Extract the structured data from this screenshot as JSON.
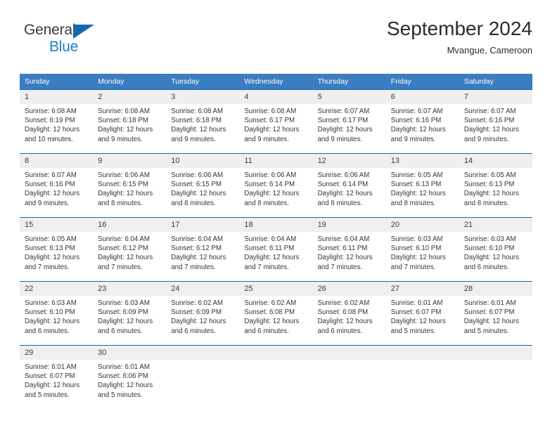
{
  "brand": {
    "name_part1": "General",
    "name_part2": "Blue",
    "accent_color": "#1a7cc4",
    "triangle_color": "#1268b3"
  },
  "header": {
    "month_title": "September 2024",
    "location": "Mvangue, Cameroon"
  },
  "calendar": {
    "header_bg": "#3a7dc0",
    "week_rule_color": "#1668b0",
    "date_band_bg": "#efefef",
    "day_names": [
      "Sunday",
      "Monday",
      "Tuesday",
      "Wednesday",
      "Thursday",
      "Friday",
      "Saturday"
    ],
    "weeks": [
      {
        "days": [
          {
            "date": "1",
            "sunrise": "Sunrise: 6:08 AM",
            "sunset": "Sunset: 6:19 PM",
            "daylight1": "Daylight: 12 hours",
            "daylight2": "and 10 minutes."
          },
          {
            "date": "2",
            "sunrise": "Sunrise: 6:08 AM",
            "sunset": "Sunset: 6:18 PM",
            "daylight1": "Daylight: 12 hours",
            "daylight2": "and 9 minutes."
          },
          {
            "date": "3",
            "sunrise": "Sunrise: 6:08 AM",
            "sunset": "Sunset: 6:18 PM",
            "daylight1": "Daylight: 12 hours",
            "daylight2": "and 9 minutes."
          },
          {
            "date": "4",
            "sunrise": "Sunrise: 6:08 AM",
            "sunset": "Sunset: 6:17 PM",
            "daylight1": "Daylight: 12 hours",
            "daylight2": "and 9 minutes."
          },
          {
            "date": "5",
            "sunrise": "Sunrise: 6:07 AM",
            "sunset": "Sunset: 6:17 PM",
            "daylight1": "Daylight: 12 hours",
            "daylight2": "and 9 minutes."
          },
          {
            "date": "6",
            "sunrise": "Sunrise: 6:07 AM",
            "sunset": "Sunset: 6:16 PM",
            "daylight1": "Daylight: 12 hours",
            "daylight2": "and 9 minutes."
          },
          {
            "date": "7",
            "sunrise": "Sunrise: 6:07 AM",
            "sunset": "Sunset: 6:16 PM",
            "daylight1": "Daylight: 12 hours",
            "daylight2": "and 9 minutes."
          }
        ]
      },
      {
        "days": [
          {
            "date": "8",
            "sunrise": "Sunrise: 6:07 AM",
            "sunset": "Sunset: 6:16 PM",
            "daylight1": "Daylight: 12 hours",
            "daylight2": "and 9 minutes."
          },
          {
            "date": "9",
            "sunrise": "Sunrise: 6:06 AM",
            "sunset": "Sunset: 6:15 PM",
            "daylight1": "Daylight: 12 hours",
            "daylight2": "and 8 minutes."
          },
          {
            "date": "10",
            "sunrise": "Sunrise: 6:06 AM",
            "sunset": "Sunset: 6:15 PM",
            "daylight1": "Daylight: 12 hours",
            "daylight2": "and 8 minutes."
          },
          {
            "date": "11",
            "sunrise": "Sunrise: 6:06 AM",
            "sunset": "Sunset: 6:14 PM",
            "daylight1": "Daylight: 12 hours",
            "daylight2": "and 8 minutes."
          },
          {
            "date": "12",
            "sunrise": "Sunrise: 6:06 AM",
            "sunset": "Sunset: 6:14 PM",
            "daylight1": "Daylight: 12 hours",
            "daylight2": "and 8 minutes."
          },
          {
            "date": "13",
            "sunrise": "Sunrise: 6:05 AM",
            "sunset": "Sunset: 6:13 PM",
            "daylight1": "Daylight: 12 hours",
            "daylight2": "and 8 minutes."
          },
          {
            "date": "14",
            "sunrise": "Sunrise: 6:05 AM",
            "sunset": "Sunset: 6:13 PM",
            "daylight1": "Daylight: 12 hours",
            "daylight2": "and 8 minutes."
          }
        ]
      },
      {
        "days": [
          {
            "date": "15",
            "sunrise": "Sunrise: 6:05 AM",
            "sunset": "Sunset: 6:13 PM",
            "daylight1": "Daylight: 12 hours",
            "daylight2": "and 7 minutes."
          },
          {
            "date": "16",
            "sunrise": "Sunrise: 6:04 AM",
            "sunset": "Sunset: 6:12 PM",
            "daylight1": "Daylight: 12 hours",
            "daylight2": "and 7 minutes."
          },
          {
            "date": "17",
            "sunrise": "Sunrise: 6:04 AM",
            "sunset": "Sunset: 6:12 PM",
            "daylight1": "Daylight: 12 hours",
            "daylight2": "and 7 minutes."
          },
          {
            "date": "18",
            "sunrise": "Sunrise: 6:04 AM",
            "sunset": "Sunset: 6:11 PM",
            "daylight1": "Daylight: 12 hours",
            "daylight2": "and 7 minutes."
          },
          {
            "date": "19",
            "sunrise": "Sunrise: 6:04 AM",
            "sunset": "Sunset: 6:11 PM",
            "daylight1": "Daylight: 12 hours",
            "daylight2": "and 7 minutes."
          },
          {
            "date": "20",
            "sunrise": "Sunrise: 6:03 AM",
            "sunset": "Sunset: 6:10 PM",
            "daylight1": "Daylight: 12 hours",
            "daylight2": "and 7 minutes."
          },
          {
            "date": "21",
            "sunrise": "Sunrise: 6:03 AM",
            "sunset": "Sunset: 6:10 PM",
            "daylight1": "Daylight: 12 hours",
            "daylight2": "and 6 minutes."
          }
        ]
      },
      {
        "days": [
          {
            "date": "22",
            "sunrise": "Sunrise: 6:03 AM",
            "sunset": "Sunset: 6:10 PM",
            "daylight1": "Daylight: 12 hours",
            "daylight2": "and 6 minutes."
          },
          {
            "date": "23",
            "sunrise": "Sunrise: 6:03 AM",
            "sunset": "Sunset: 6:09 PM",
            "daylight1": "Daylight: 12 hours",
            "daylight2": "and 6 minutes."
          },
          {
            "date": "24",
            "sunrise": "Sunrise: 6:02 AM",
            "sunset": "Sunset: 6:09 PM",
            "daylight1": "Daylight: 12 hours",
            "daylight2": "and 6 minutes."
          },
          {
            "date": "25",
            "sunrise": "Sunrise: 6:02 AM",
            "sunset": "Sunset: 6:08 PM",
            "daylight1": "Daylight: 12 hours",
            "daylight2": "and 6 minutes."
          },
          {
            "date": "26",
            "sunrise": "Sunrise: 6:02 AM",
            "sunset": "Sunset: 6:08 PM",
            "daylight1": "Daylight: 12 hours",
            "daylight2": "and 6 minutes."
          },
          {
            "date": "27",
            "sunrise": "Sunrise: 6:01 AM",
            "sunset": "Sunset: 6:07 PM",
            "daylight1": "Daylight: 12 hours",
            "daylight2": "and 5 minutes."
          },
          {
            "date": "28",
            "sunrise": "Sunrise: 6:01 AM",
            "sunset": "Sunset: 6:07 PM",
            "daylight1": "Daylight: 12 hours",
            "daylight2": "and 5 minutes."
          }
        ]
      },
      {
        "days": [
          {
            "date": "29",
            "sunrise": "Sunrise: 6:01 AM",
            "sunset": "Sunset: 6:07 PM",
            "daylight1": "Daylight: 12 hours",
            "daylight2": "and 5 minutes."
          },
          {
            "date": "30",
            "sunrise": "Sunrise: 6:01 AM",
            "sunset": "Sunset: 6:06 PM",
            "daylight1": "Daylight: 12 hours",
            "daylight2": "and 5 minutes."
          },
          {
            "date": "",
            "sunrise": "",
            "sunset": "",
            "daylight1": "",
            "daylight2": ""
          },
          {
            "date": "",
            "sunrise": "",
            "sunset": "",
            "daylight1": "",
            "daylight2": ""
          },
          {
            "date": "",
            "sunrise": "",
            "sunset": "",
            "daylight1": "",
            "daylight2": ""
          },
          {
            "date": "",
            "sunrise": "",
            "sunset": "",
            "daylight1": "",
            "daylight2": ""
          },
          {
            "date": "",
            "sunrise": "",
            "sunset": "",
            "daylight1": "",
            "daylight2": ""
          }
        ]
      }
    ]
  }
}
